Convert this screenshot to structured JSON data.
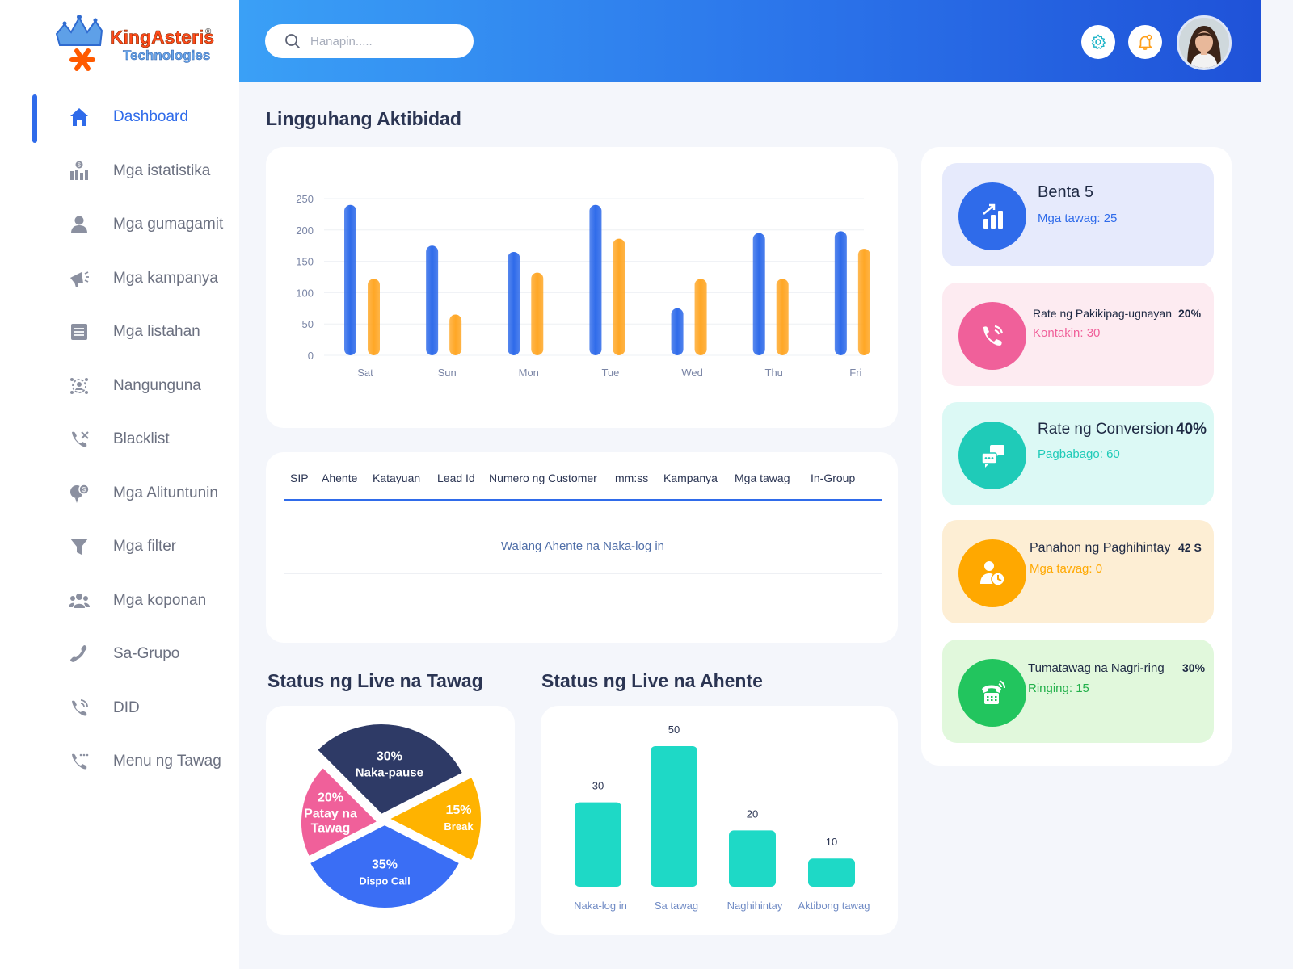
{
  "brand": {
    "name": "KingAsterisk",
    "subtitle": "Technologies",
    "registered": "®"
  },
  "search": {
    "placeholder": "Hanapin....."
  },
  "sidebar": {
    "items": [
      {
        "label": "Dashboard",
        "icon": "home-icon",
        "active": true
      },
      {
        "label": "Mga istatistika",
        "icon": "statistics-icon"
      },
      {
        "label": "Mga gumagamit",
        "icon": "user-icon"
      },
      {
        "label": "Mga kampanya",
        "icon": "megaphone-icon"
      },
      {
        "label": "Mga listahan",
        "icon": "list-icon"
      },
      {
        "label": "Nangunguna",
        "icon": "leads-icon"
      },
      {
        "label": "Blacklist",
        "icon": "blocked-call-icon"
      },
      {
        "label": "Mga Alituntunin",
        "icon": "rules-icon"
      },
      {
        "label": "Mga filter",
        "icon": "filter-icon"
      },
      {
        "label": "Mga koponan",
        "icon": "team-icon"
      },
      {
        "label": "Sa-Grupo",
        "icon": "phone-icon"
      },
      {
        "label": "DID",
        "icon": "did-phone-icon"
      },
      {
        "label": "Menu ng Tawag",
        "icon": "call-menu-icon"
      }
    ]
  },
  "colors": {
    "primary": "#2f6bea",
    "orange": "#ffa726",
    "teal": "#1ed9c6",
    "navy": "#2e3a66",
    "pink": "#f0609a",
    "yellow": "#ffb300",
    "blue": "#3a6ef5"
  },
  "weekly": {
    "title": "Lingguhang Aktibidad",
    "chart_data": {
      "type": "bar",
      "categories": [
        "Sat",
        "Sun",
        "Mon",
        "Tue",
        "Wed",
        "Thu",
        "Fri"
      ],
      "series": [
        {
          "values": [
            240,
            175,
            165,
            240,
            75,
            195,
            198
          ],
          "color": "#2f6bea"
        },
        {
          "values": [
            122,
            65,
            132,
            186,
            122,
            122,
            170
          ],
          "color": "#ffa726"
        }
      ],
      "yticks": [
        0,
        50,
        100,
        150,
        200,
        250
      ],
      "ylim": [
        0,
        250
      ],
      "grid": true
    }
  },
  "agents_table": {
    "columns": [
      "SIP",
      "Ahente",
      "Katayuan",
      "Lead Id",
      "Numero ng Customer",
      "mm:ss",
      "Kampanya",
      "Mga tawag",
      "In-Group"
    ],
    "empty_text": "Walang Ahente na Naka-log in"
  },
  "live_calls": {
    "title": "Status ng Live na Tawag",
    "chart_data": {
      "type": "pie",
      "slices": [
        {
          "label": "Naka-pause",
          "value": 30,
          "pct": "30%",
          "color": "#2e3a66"
        },
        {
          "label": "Break",
          "value": 15,
          "pct": "15%",
          "color": "#ffb300"
        },
        {
          "label": "Dispo Call",
          "value": 35,
          "pct": "35%",
          "color": "#3a6ef5"
        },
        {
          "label": "Patay na Tawag",
          "value": 20,
          "pct": "20%",
          "color": "#f0609a"
        }
      ]
    }
  },
  "live_agents": {
    "title": "Status ng Live na Ahente",
    "chart_data": {
      "type": "bar",
      "categories": [
        "Naka-log in",
        "Sa tawag",
        "Naghihintay",
        "Aktibong tawag"
      ],
      "values": [
        30,
        50,
        20,
        10
      ],
      "ylim": [
        0,
        50
      ]
    }
  },
  "stats": [
    {
      "title": "Benta 5",
      "sub_label": "Mga tawag:",
      "sub_value": "25",
      "value": "",
      "bg": "#e6eafc",
      "circle": "#2f6bea",
      "sub_color": "#2f6bea",
      "icon": "sales-chart-icon"
    },
    {
      "title": "Rate ng Pakikipag-ugnayan",
      "value": "20%",
      "sub_label": "Kontakin:",
      "sub_value": "30",
      "bg": "#fdebf1",
      "circle": "#f0609a",
      "sub_color": "#f0609a",
      "icon": "phone-ring-icon"
    },
    {
      "title": "Rate ng Conversion",
      "value": "40%",
      "sub_label": "Pagbabago:",
      "sub_value": "60",
      "bg": "#dcf9f5",
      "circle": "#1fcbb8",
      "sub_color": "#1fcbb8",
      "icon": "chat-icon"
    },
    {
      "title": "Panahon ng Paghihintay",
      "value": "42 S",
      "sub_label": "Mga tawag:",
      "sub_value": "0",
      "bg": "#fdeed4",
      "circle": "#ffa800",
      "sub_color": "#ffa800",
      "icon": "user-clock-icon"
    },
    {
      "title": "Tumatawag na Nagri-ring",
      "value": "30%",
      "sub_label": "Ringing:",
      "sub_value": "15",
      "bg": "#e1f8dc",
      "circle": "#22c55e",
      "sub_color": "#22b04a",
      "icon": "ringing-phone-icon"
    }
  ]
}
